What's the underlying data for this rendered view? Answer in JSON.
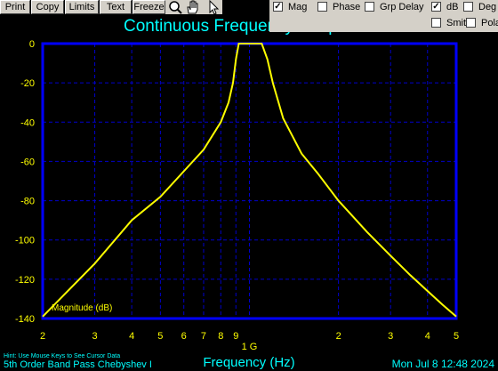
{
  "toolbar": {
    "buttons": [
      {
        "label": "Print"
      },
      {
        "label": "Copy"
      },
      {
        "label": "Limits"
      },
      {
        "label": "Text"
      },
      {
        "label": "Freeze"
      }
    ],
    "icons": [
      "zoom-icon",
      "hand-pan-icon",
      "pointer-icon"
    ]
  },
  "options": {
    "mag": {
      "label": "Mag",
      "checked": true
    },
    "phase": {
      "label": "Phase",
      "checked": false
    },
    "grp_delay": {
      "label": "Grp Delay",
      "checked": false
    },
    "db": {
      "label": "dB",
      "checked": true
    },
    "deg": {
      "label": "Deg",
      "checked": false
    },
    "smith": {
      "label": "Smith",
      "checked": false
    },
    "polar": {
      "label": "Polar",
      "checked": false
    }
  },
  "colors": {
    "background": "#000000",
    "plot_border": "#0000ff",
    "grid": "#0000cc",
    "trace": "#ffff00",
    "title": "#00ffff",
    "tick_labels": "#ffff00",
    "status_text": "#00ffff"
  },
  "chart_data": {
    "type": "line",
    "title": "Continuous Frequency Response",
    "xlabel": "Frequency (Hz)",
    "ylabel": "",
    "x_scale": "log",
    "xlim": [
      200000000.0,
      5000000000.0
    ],
    "ylim": [
      -140,
      0
    ],
    "y_ticks": [
      0,
      -20,
      -40,
      -60,
      -80,
      -100,
      -120,
      -140
    ],
    "x_ticks": [
      {
        "value": 200000000.0,
        "label": "2"
      },
      {
        "value": 300000000.0,
        "label": "3"
      },
      {
        "value": 400000000.0,
        "label": "4"
      },
      {
        "value": 500000000.0,
        "label": "5"
      },
      {
        "value": 600000000.0,
        "label": "6"
      },
      {
        "value": 700000000.0,
        "label": "7"
      },
      {
        "value": 800000000.0,
        "label": "8"
      },
      {
        "value": 900000000.0,
        "label": "9"
      },
      {
        "value": 1000000000.0,
        "label": "1 G"
      },
      {
        "value": 2000000000.0,
        "label": "2"
      },
      {
        "value": 3000000000.0,
        "label": "3"
      },
      {
        "value": 4000000000.0,
        "label": "4"
      },
      {
        "value": 5000000000.0,
        "label": "5"
      }
    ],
    "grid": true,
    "series": [
      {
        "name": "Magnitude (dB)",
        "x": [
          200000000.0,
          300000000.0,
          400000000.0,
          500000000.0,
          600000000.0,
          700000000.0,
          800000000.0,
          850000000.0,
          880000000.0,
          900000000.0,
          920000000.0,
          950000000.0,
          1000000000.0,
          1050000000.0,
          1100000000.0,
          1150000000.0,
          1200000000.0,
          1300000000.0,
          1500000000.0,
          1700000000.0,
          2000000000.0,
          2500000000.0,
          3000000000.0,
          3500000000.0,
          4000000000.0,
          4500000000.0,
          5000000000.0
        ],
        "y": [
          -139,
          -112,
          -90,
          -78,
          -65,
          -54,
          -40,
          -30,
          -20,
          -8,
          0,
          0,
          0,
          0,
          0,
          -8,
          -20,
          -38,
          -56,
          -66,
          -80,
          -96,
          -108,
          -118,
          -126,
          -133,
          -139
        ]
      }
    ]
  },
  "status": {
    "hint": "Hint: Use Mouse Keys to See Cursor Data",
    "filter_name": "5th Order Band Pass Chebyshev I",
    "datetime": "Mon Jul  8 12:48 2024"
  }
}
